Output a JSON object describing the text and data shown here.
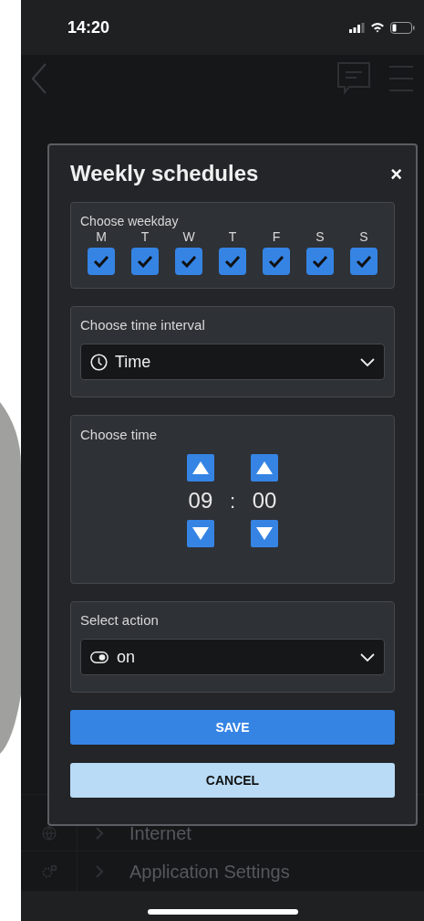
{
  "status_bar": {
    "time": "14:20"
  },
  "background": {
    "rows": [
      {
        "label": "Internet",
        "kind": "globe"
      },
      {
        "label": "Application Settings",
        "kind": "gears"
      }
    ]
  },
  "dialog": {
    "title": "Weekly schedules",
    "close": "×",
    "weekday": {
      "label": "Choose weekday",
      "days": [
        {
          "label": "M",
          "checked": true
        },
        {
          "label": "T",
          "checked": true
        },
        {
          "label": "W",
          "checked": true
        },
        {
          "label": "T",
          "checked": true
        },
        {
          "label": "F",
          "checked": true
        },
        {
          "label": "S",
          "checked": true
        },
        {
          "label": "S",
          "checked": true
        }
      ]
    },
    "interval": {
      "label": "Choose time interval",
      "value": "Time"
    },
    "time": {
      "label": "Choose time",
      "hours": "09",
      "separator": ":",
      "minutes": "00"
    },
    "action": {
      "label": "Select action",
      "value": "on"
    },
    "buttons": [
      {
        "label": "SAVE",
        "kind": "primary"
      },
      {
        "label": "CANCEL",
        "kind": "secondary"
      }
    ]
  }
}
